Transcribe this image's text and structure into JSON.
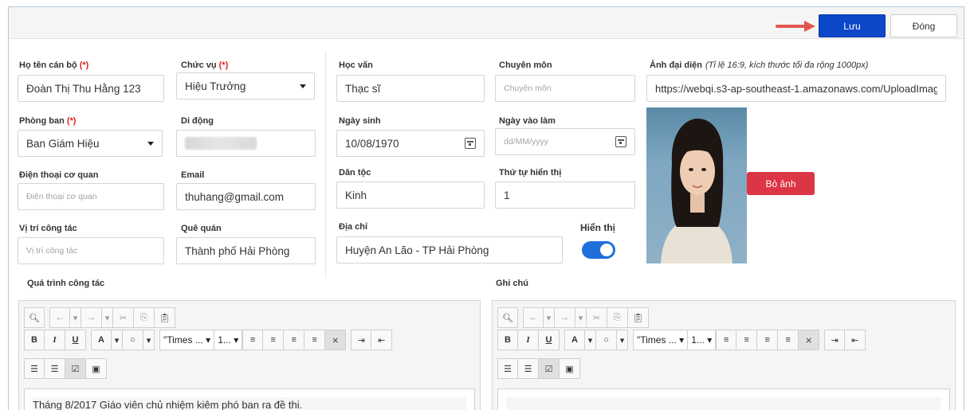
{
  "toolbar": {
    "save_label": "Lưu",
    "close_label": "Đóng"
  },
  "form": {
    "full_name": {
      "label": "Họ tên cán bộ",
      "required": "(*)",
      "value": "Đoàn Thị Thu Hằng 123"
    },
    "position": {
      "label": "Chức vụ",
      "required": "(*)",
      "value": "Hiệu Trưởng"
    },
    "department": {
      "label": "Phòng ban",
      "required": "(*)",
      "value": "Ban Giám Hiệu"
    },
    "mobile": {
      "label": "Di động"
    },
    "office_phone": {
      "label": "Điện thoại cơ quan",
      "placeholder": "Điện thoại cơ quan"
    },
    "email": {
      "label": "Email",
      "value": "thuhang@gmail.com"
    },
    "work_position": {
      "label": "Vị trí công tác",
      "placeholder": "Vị trí công tác"
    },
    "hometown": {
      "label": "Quê quán",
      "value": "Thành phố Hải Phòng"
    },
    "education": {
      "label": "Học vấn",
      "value": "Thạc sĩ"
    },
    "specialty": {
      "label": "Chuyên môn",
      "placeholder": "Chuyên môn"
    },
    "birth_date": {
      "label": "Ngày sinh",
      "value": "10/08/1970"
    },
    "start_date": {
      "label": "Ngày vào làm",
      "placeholder": "dd/MM/yyyy"
    },
    "ethnicity": {
      "label": "Dân tộc",
      "value": "Kinh"
    },
    "display_order": {
      "label": "Thứ tự hiển thị",
      "value": "1"
    },
    "address": {
      "label": "Địa chỉ",
      "value": "Huyện An Lão - TP Hải Phòng"
    },
    "visible": {
      "label": "Hiển thị",
      "on": true
    },
    "avatar": {
      "label": "Ảnh đại diện",
      "note": "(Tỉ lệ 16:9, kích thước tối đa rộng 1000px)",
      "url": "https://webqi.s3-ap-southeast-1.amazonaws.com/UploadImag",
      "remove_label": "Bỏ ảnh"
    }
  },
  "work_history": {
    "label": "Quá trình công tác",
    "font_name": "\"Times ...",
    "font_size": "1...",
    "content": "Tháng 8/2017 Giáo viên chủ nhiệm kiêm phó ban ra đề thi."
  },
  "notes": {
    "label": "Ghi chú",
    "font_name": "\"Times ...",
    "font_size": "1...",
    "content": ""
  },
  "colors": {
    "accent": "#0d47c9",
    "danger": "#dc3545",
    "required": "#e02020",
    "toggle": "#1e6fd9"
  }
}
